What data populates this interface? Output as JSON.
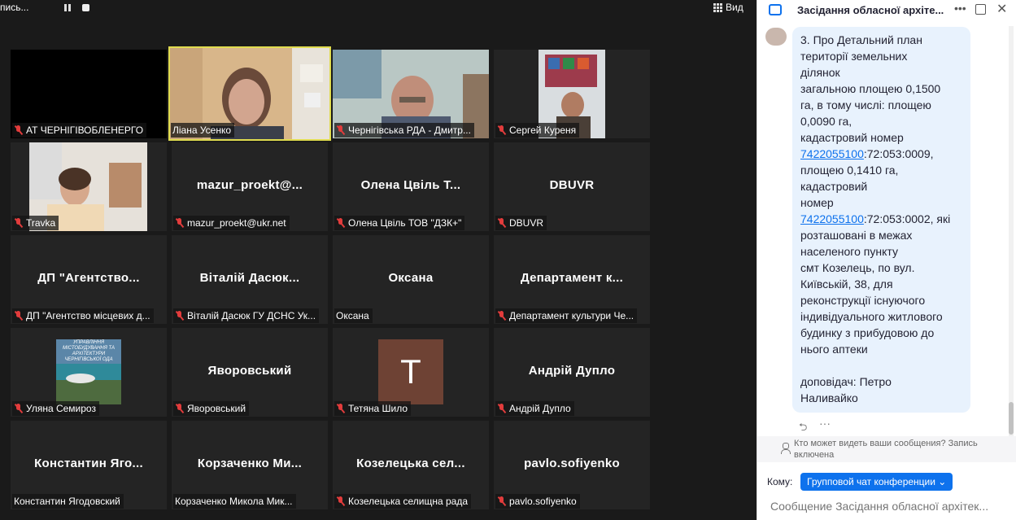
{
  "topbar": {
    "recording_label": "пись...",
    "view_label": "Вид"
  },
  "tiles": [
    {
      "label": "АТ ЧЕРНІГІВОБЛЕНЕРГО",
      "bigname": ""
    },
    {
      "label": "Ліана Усенко",
      "bigname": ""
    },
    {
      "label": "Чернігівська РДА - Дмитр...",
      "bigname": ""
    },
    {
      "label": "Сергей Куреня",
      "bigname": ""
    },
    {
      "label": "Travka",
      "bigname": ""
    },
    {
      "label": "mazur_proekt@ukr.net",
      "bigname": "mazur_proekt@..."
    },
    {
      "label": "Олена Цвіль ТОВ \"ДЗК+\"",
      "bigname": "Олена  Цвіль  Т..."
    },
    {
      "label": "DBUVR",
      "bigname": "DBUVR"
    },
    {
      "label": "ДП \"Агентство місцевих д...",
      "bigname": "ДП  \"Агентство..."
    },
    {
      "label": "Віталій Дасюк ГУ ДСНС Ук...",
      "bigname": "Віталій  Дасюк..."
    },
    {
      "label": "Оксана",
      "bigname": "Оксана"
    },
    {
      "label": "Департамент культури Че...",
      "bigname": "Департамент  к..."
    },
    {
      "label": "Уляна Семироз",
      "bigname": ""
    },
    {
      "label": "Яворовський",
      "bigname": "Яворовський"
    },
    {
      "label": "Тетяна Шило",
      "bigname": "",
      "avatar_letter": "T"
    },
    {
      "label": "Андрій Дупло",
      "bigname": "Андрій Дупло"
    },
    {
      "label": "Константин Ягодовский",
      "bigname": "Константин  Яго..."
    },
    {
      "label": "Корзаченко Микола Мик...",
      "bigname": "Корзаченко  Ми..."
    },
    {
      "label": "Козелецька селищна рада",
      "bigname": "Козелецька  сел..."
    },
    {
      "label": "pavlo.sofiyenko",
      "bigname": "pavlo.sofiyenko"
    }
  ],
  "poster_text": [
    "УПРАВЛІННЯ",
    "МІСТОБУДУВАННЯ ТА",
    "АРХІТЕКТУРИ",
    "ЧЕРНІГІВСЬКОЇ ОДА"
  ],
  "chat": {
    "title": "Засідання обласної архіте...",
    "message_lines": [
      "3.  Про Детальний план",
      "території земельних",
      "ділянок",
      "загальною площею 0,1500",
      "га, в тому числі: площею",
      "0,0090 га,",
      "кадастровий номер",
      "",
      "площею 0,1410 га,",
      "кадастровий",
      "номер",
      "",
      "розташовані в межах",
      "населеного пункту",
      "смт Козелець, по вул.",
      "Київській, 38, для",
      "реконструкції існуючого",
      "індивідуального житлового",
      "будинку з прибудовою до",
      "нього аптеки",
      "",
      "доповідач: Петро",
      "Наливайко"
    ],
    "link1": "7422055100",
    "link1_rest": ":72:053:0009,",
    "link2": "7422055100",
    "link2_rest": ":72:053:0002, які",
    "who_sees": "Кто может видеть ваши сообщения? Запись включена",
    "to_label": "Кому:",
    "to_value": "Групповой чат конференции ⌄",
    "input_placeholder": "Сообщение Засідання обласної архітек..."
  }
}
